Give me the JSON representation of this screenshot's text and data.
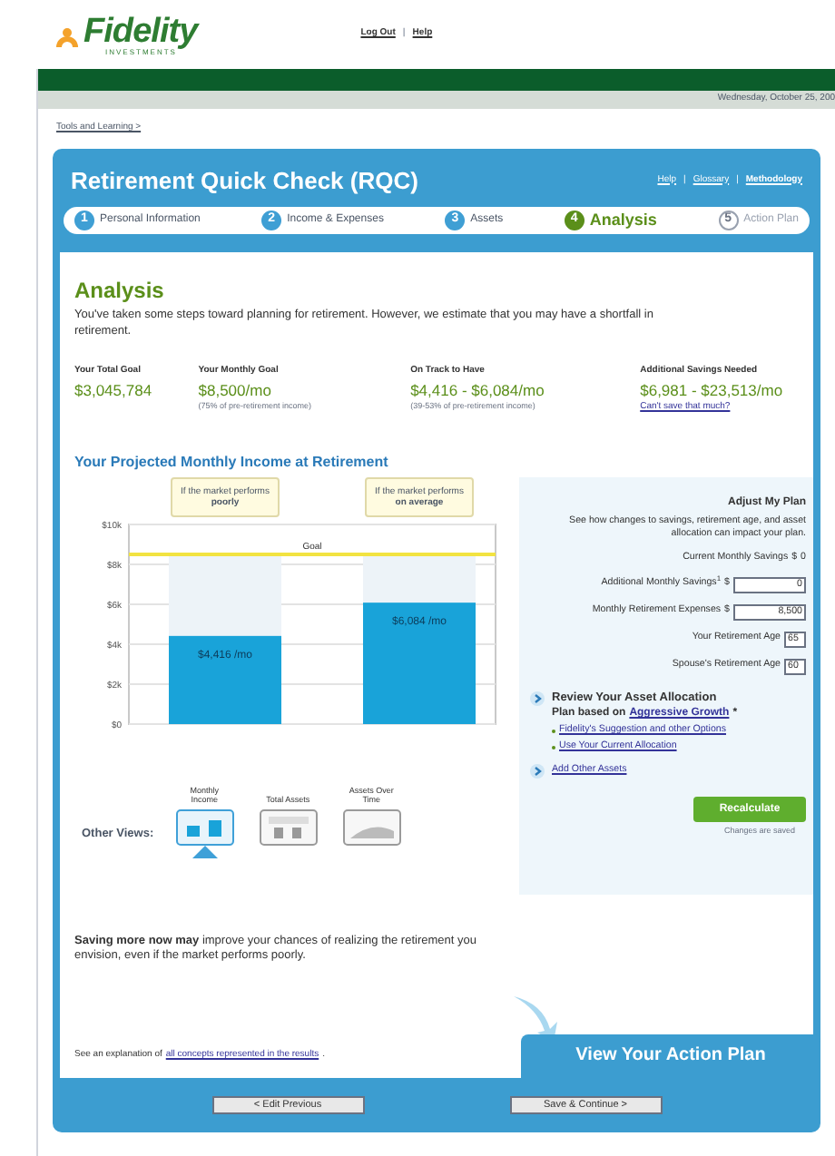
{
  "header": {
    "logo": "Fidelity",
    "logo_sub": "INVESTMENTS",
    "links": [
      "Log Out",
      "Help"
    ],
    "separator": "|",
    "date": "Wednesday, October 25, 200"
  },
  "breadcrumb": "Tools and Learning >",
  "panel": {
    "title": "Retirement Quick Check (RQC)",
    "links": [
      "Help",
      "Glossary",
      "Methodology"
    ],
    "separators": [
      "|",
      "|"
    ]
  },
  "steps": [
    {
      "number": "1",
      "label": "Personal Information",
      "done": true,
      "selected": false
    },
    {
      "number": "2",
      "label": "Income & Expenses",
      "done": true,
      "selected": false
    },
    {
      "number": "3",
      "label": "Assets",
      "done": true,
      "selected": false
    },
    {
      "number": "4",
      "label": "Analysis",
      "done": false,
      "selected": true
    },
    {
      "number": "5",
      "label": "Action Plan",
      "done": false,
      "selected": false
    }
  ],
  "analysis": {
    "heading": "Analysis",
    "intro": "You've taken some steps toward planning for retirement. However, we estimate that you may have a shortfall in retirement.",
    "metrics": [
      {
        "label": "Your Total Goal",
        "value": "$3,045,784"
      },
      {
        "label": "Your Monthly Goal",
        "value": "$8,500/mo",
        "note": "(75% of pre-retirement income)"
      },
      {
        "label": "On Track to Have",
        "value": "$4,416 - $6,084/mo",
        "note": "(39-53% of pre-retirement income)"
      },
      {
        "label": "Additional Savings Needed",
        "value": "$6,981 - $23,513/mo",
        "link": "Can't save that much?"
      }
    ]
  },
  "projection": {
    "heading": "Your Projected Monthly Income at Retirement",
    "chart_data": {
      "type": "bar",
      "categories": [
        "If the market performs **poorly**",
        "If the market performs **on average**"
      ],
      "stacked": true,
      "grid": true,
      "series": [
        {
          "color": "#19a3d9",
          "values": [
            4416,
            6084
          ]
        },
        {
          "color": "#edf3f8",
          "values": [
            4100,
            2400
          ]
        }
      ],
      "ylim": [
        0,
        10000
      ],
      "yticks": [
        {
          "value": 0,
          "label": "$0"
        },
        {
          "value": 2000,
          "label": "$2k"
        },
        {
          "value": 4000,
          "label": "$4k"
        },
        {
          "value": 6000,
          "label": "$6k"
        },
        {
          "value": 8000,
          "label": "$8k"
        },
        {
          "value": 10000,
          "label": "$10k"
        }
      ],
      "value_labels": [
        "$4,416 /mo",
        "$6,084 /mo"
      ],
      "ref_lines": [
        {
          "axis": "y",
          "value": 8500,
          "label": "Goal",
          "color": "#f2e341"
        }
      ]
    },
    "other_views_label": "Other Views:",
    "views": [
      {
        "label": "Monthly Income",
        "kind": "bars",
        "selected": true
      },
      {
        "label": "Total Assets",
        "kind": "table",
        "selected": false
      },
      {
        "label": "Assets Over Time",
        "kind": "area",
        "selected": false
      }
    ]
  },
  "adjust": {
    "heading": "Adjust My Plan",
    "intro": "See how changes to savings, retirement age, and asset allocation can impact your plan.",
    "fields": [
      {
        "kind": "text",
        "label": "Current Monthly Savings",
        "currency": "$",
        "value": "0"
      },
      {
        "kind": "input",
        "label": "Additional Monthly Savings$^{1}$",
        "currency": "$",
        "value": "0"
      },
      {
        "kind": "input",
        "label": "Monthly Retirement Expenses",
        "currency": "$",
        "value": "8,500"
      },
      {
        "kind": "input",
        "label": "Your Retirement Age",
        "value": "65"
      },
      {
        "kind": "input",
        "label": "Spouse's Retirement Age",
        "value": "60"
      }
    ],
    "allocation_heading": "Review Your Asset Allocation",
    "plan_prefix": "Plan based on",
    "plan_link": "Aggressive Growth",
    "plan_suffix": "*",
    "allocation_links": [
      "Fidelity's Suggestion and other Options",
      "Use Your Current Allocation"
    ],
    "other_assets": "Add Other Assets",
    "recalculate": "Recalculate",
    "saved_note": "Changes are saved"
  },
  "tip": "**Saving more now may** improve your chances of realizing the retirement you envision, even if the market performs poorly.",
  "explanation": {
    "prefix": "See an explanation of",
    "link": "all concepts represented in the results",
    "suffix": "."
  },
  "action_plan": "View Your Action Plan",
  "buttons": [
    "< Edit Previous",
    "Save & Continue >"
  ]
}
